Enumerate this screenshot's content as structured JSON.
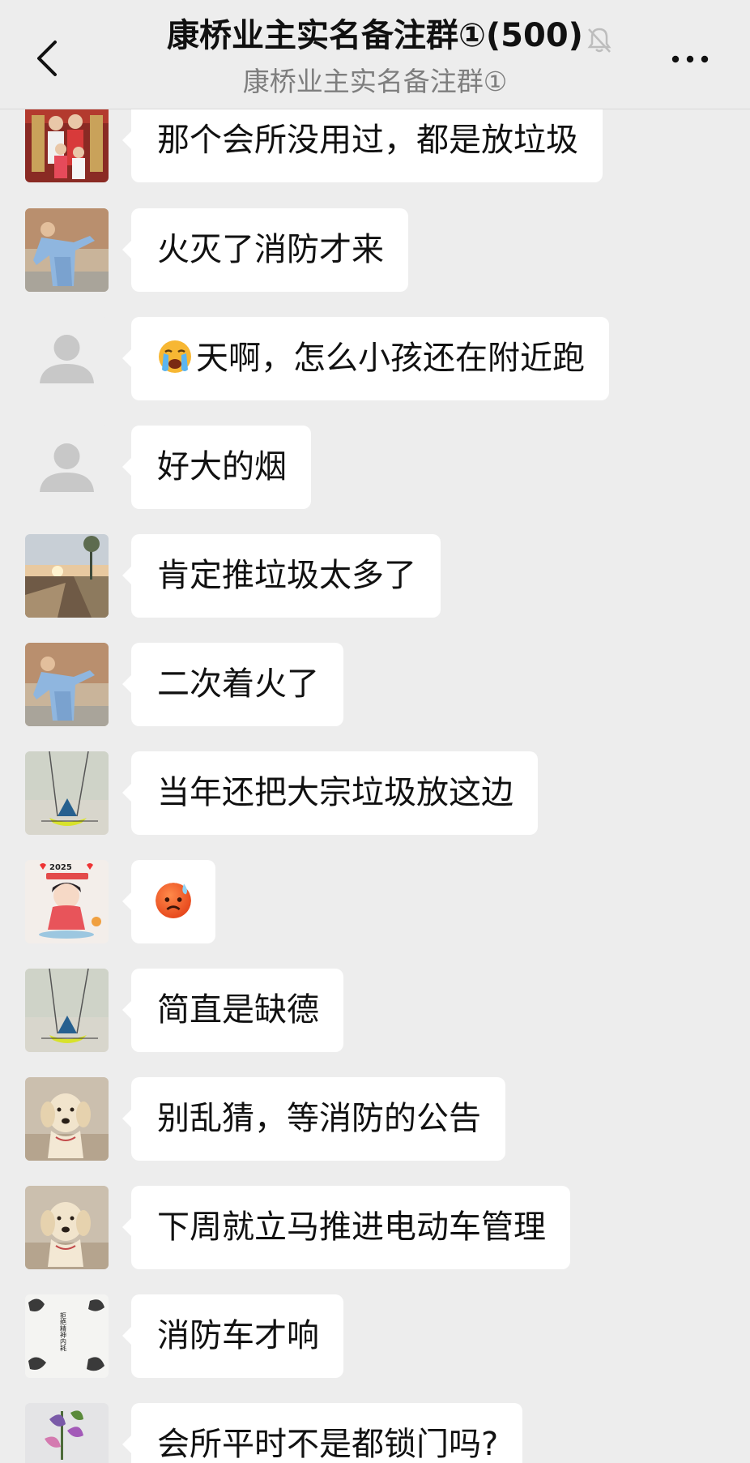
{
  "header": {
    "title": "康桥业主实名备注群①(500)",
    "subtitle": "康桥业主实名备注群①",
    "back_icon": "chevron-left-icon",
    "mute_icon": "bell-muted-icon",
    "more_icon": "more-dots-icon"
  },
  "messages": [
    {
      "text": "那个会所没用过，都是放垃圾",
      "avatar": "family-photo-avatar"
    },
    {
      "text": "火灭了消防才来",
      "avatar": "boy-blue-robe-avatar"
    },
    {
      "text": "天啊，怎么小孩还在附近跑",
      "avatar": "default-person-avatar",
      "emoji": "loudly-crying-face"
    },
    {
      "text": "好大的烟",
      "avatar": "default-person-avatar"
    },
    {
      "text": "肯定推垃圾太多了",
      "avatar": "sunset-path-avatar"
    },
    {
      "text": "二次着火了",
      "avatar": "boy-blue-robe-avatar"
    },
    {
      "text": "当年还把大宗垃圾放这边",
      "avatar": "swing-avatar"
    },
    {
      "text": "",
      "avatar": "girl-2025-avatar",
      "emoji": "anxious-face-with-sweat",
      "year_badge": "2025"
    },
    {
      "text": "简直是缺德",
      "avatar": "swing-avatar"
    },
    {
      "text": "别乱猜，等消防的公告",
      "avatar": "golden-retriever-avatar"
    },
    {
      "text": "下周就立马推进电动车管理",
      "avatar": "golden-retriever-avatar"
    },
    {
      "text": "消防车才响",
      "avatar": "ink-cats-avatar",
      "avatar_text": "拒绝精神内耗"
    },
    {
      "text": "会所平时不是都锁门吗?",
      "avatar": "flower-avatar"
    }
  ],
  "colors": {
    "background": "#ededed",
    "bubble": "#ffffff",
    "text": "#111111",
    "subtitle": "#7e7e7e"
  }
}
